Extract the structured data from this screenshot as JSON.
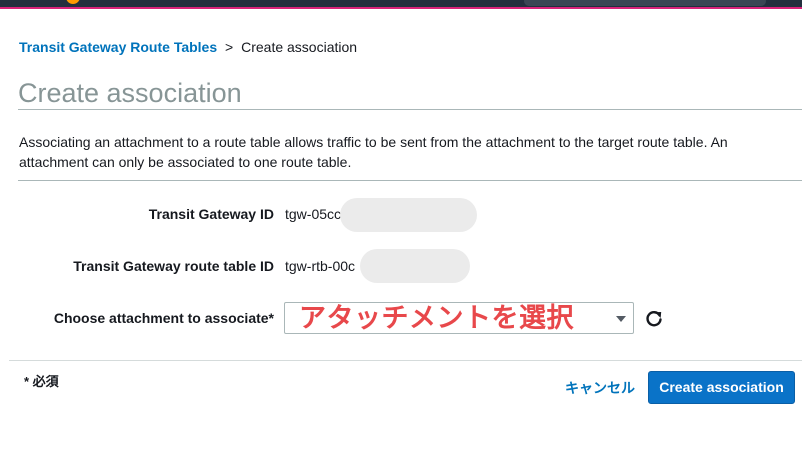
{
  "breadcrumb": {
    "parent": "Transit Gateway Route Tables",
    "separator": ">",
    "current": "Create association"
  },
  "page": {
    "title": "Create association",
    "description": "Associating an attachment to a route table allows traffic to be sent from the attachment to the target route table. An attachment can only be associated to one route table."
  },
  "form": {
    "transit_gateway_id": {
      "label": "Transit Gateway ID",
      "value": "tgw-05cc"
    },
    "route_table_id": {
      "label": "Transit Gateway route table ID",
      "value": "tgw-rtb-00c"
    },
    "attachment": {
      "label": "Choose attachment to associate*",
      "selected": "アタッチメントを選択"
    }
  },
  "footer": {
    "required_note": "* 必須",
    "cancel_label": "キャンセル",
    "submit_label": "Create association"
  },
  "colors": {
    "link": "#0073bb",
    "primary_button": "#0a73c8",
    "select_text": "#e8484b",
    "title": "#879596"
  },
  "icons": {
    "refresh": "refresh-icon",
    "dropdown": "chevron-down-icon"
  }
}
